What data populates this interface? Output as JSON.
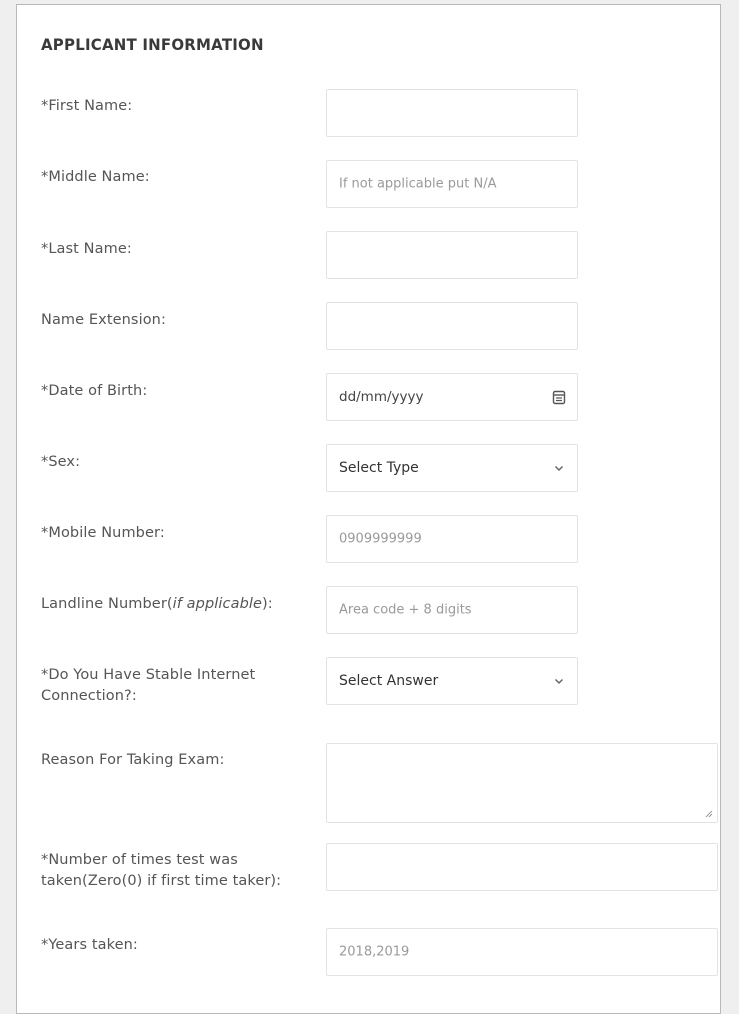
{
  "form": {
    "section_title": "APPLICANT INFORMATION",
    "first_name": {
      "label": "*First Name:",
      "value": ""
    },
    "middle_name": {
      "label": "*Middle Name:",
      "placeholder": "If not applicable put N/A"
    },
    "last_name": {
      "label": "*Last Name:",
      "value": ""
    },
    "name_extension": {
      "label": "Name Extension:",
      "value": ""
    },
    "date_of_birth": {
      "label": "*Date of Birth:",
      "placeholder": "dd/mm/yyyy",
      "icon": "calendar-icon"
    },
    "sex": {
      "label": "*Sex:",
      "selected": "Select Type",
      "icon": "chevron-down-icon"
    },
    "mobile_number": {
      "label": "*Mobile Number:",
      "placeholder": "0909999999"
    },
    "landline_number": {
      "label_prefix": "Landline Number(",
      "label_italic": "if applicable",
      "label_suffix": "):",
      "placeholder": "Area code + 8 digits"
    },
    "stable_internet": {
      "label_line1": "*Do You Have Stable Internet",
      "label_line2": "Connection?:",
      "selected": "Select Answer",
      "icon": "chevron-down-icon"
    },
    "reason": {
      "label": "Reason For Taking Exam:",
      "value": ""
    },
    "times_taken": {
      "label_line1": "*Number of times test was",
      "label_line2": "taken(Zero(0) if first time taker):",
      "value": ""
    },
    "years_taken": {
      "label": "*Years taken:",
      "placeholder": "2018,2019"
    }
  },
  "colors": {
    "panel_border": "#b8b8b8",
    "field_border": "#e3e3e3",
    "label": "#555555",
    "placeholder": "#9a9a9a"
  }
}
